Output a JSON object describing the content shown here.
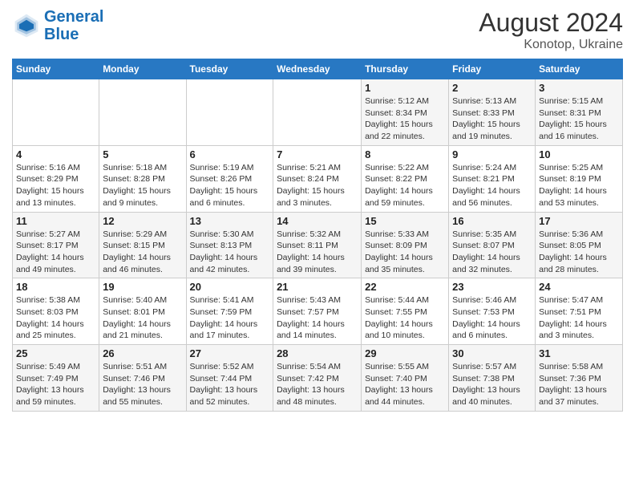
{
  "logo": {
    "text_general": "General",
    "text_blue": "Blue"
  },
  "title": "August 2024",
  "subtitle": "Konotop, Ukraine",
  "days_of_week": [
    "Sunday",
    "Monday",
    "Tuesday",
    "Wednesday",
    "Thursday",
    "Friday",
    "Saturday"
  ],
  "weeks": [
    [
      {
        "day": "",
        "info": ""
      },
      {
        "day": "",
        "info": ""
      },
      {
        "day": "",
        "info": ""
      },
      {
        "day": "",
        "info": ""
      },
      {
        "day": "1",
        "info": "Sunrise: 5:12 AM\nSunset: 8:34 PM\nDaylight: 15 hours and 22 minutes."
      },
      {
        "day": "2",
        "info": "Sunrise: 5:13 AM\nSunset: 8:33 PM\nDaylight: 15 hours and 19 minutes."
      },
      {
        "day": "3",
        "info": "Sunrise: 5:15 AM\nSunset: 8:31 PM\nDaylight: 15 hours and 16 minutes."
      }
    ],
    [
      {
        "day": "4",
        "info": "Sunrise: 5:16 AM\nSunset: 8:29 PM\nDaylight: 15 hours and 13 minutes."
      },
      {
        "day": "5",
        "info": "Sunrise: 5:18 AM\nSunset: 8:28 PM\nDaylight: 15 hours and 9 minutes."
      },
      {
        "day": "6",
        "info": "Sunrise: 5:19 AM\nSunset: 8:26 PM\nDaylight: 15 hours and 6 minutes."
      },
      {
        "day": "7",
        "info": "Sunrise: 5:21 AM\nSunset: 8:24 PM\nDaylight: 15 hours and 3 minutes."
      },
      {
        "day": "8",
        "info": "Sunrise: 5:22 AM\nSunset: 8:22 PM\nDaylight: 14 hours and 59 minutes."
      },
      {
        "day": "9",
        "info": "Sunrise: 5:24 AM\nSunset: 8:21 PM\nDaylight: 14 hours and 56 minutes."
      },
      {
        "day": "10",
        "info": "Sunrise: 5:25 AM\nSunset: 8:19 PM\nDaylight: 14 hours and 53 minutes."
      }
    ],
    [
      {
        "day": "11",
        "info": "Sunrise: 5:27 AM\nSunset: 8:17 PM\nDaylight: 14 hours and 49 minutes."
      },
      {
        "day": "12",
        "info": "Sunrise: 5:29 AM\nSunset: 8:15 PM\nDaylight: 14 hours and 46 minutes."
      },
      {
        "day": "13",
        "info": "Sunrise: 5:30 AM\nSunset: 8:13 PM\nDaylight: 14 hours and 42 minutes."
      },
      {
        "day": "14",
        "info": "Sunrise: 5:32 AM\nSunset: 8:11 PM\nDaylight: 14 hours and 39 minutes."
      },
      {
        "day": "15",
        "info": "Sunrise: 5:33 AM\nSunset: 8:09 PM\nDaylight: 14 hours and 35 minutes."
      },
      {
        "day": "16",
        "info": "Sunrise: 5:35 AM\nSunset: 8:07 PM\nDaylight: 14 hours and 32 minutes."
      },
      {
        "day": "17",
        "info": "Sunrise: 5:36 AM\nSunset: 8:05 PM\nDaylight: 14 hours and 28 minutes."
      }
    ],
    [
      {
        "day": "18",
        "info": "Sunrise: 5:38 AM\nSunset: 8:03 PM\nDaylight: 14 hours and 25 minutes."
      },
      {
        "day": "19",
        "info": "Sunrise: 5:40 AM\nSunset: 8:01 PM\nDaylight: 14 hours and 21 minutes."
      },
      {
        "day": "20",
        "info": "Sunrise: 5:41 AM\nSunset: 7:59 PM\nDaylight: 14 hours and 17 minutes."
      },
      {
        "day": "21",
        "info": "Sunrise: 5:43 AM\nSunset: 7:57 PM\nDaylight: 14 hours and 14 minutes."
      },
      {
        "day": "22",
        "info": "Sunrise: 5:44 AM\nSunset: 7:55 PM\nDaylight: 14 hours and 10 minutes."
      },
      {
        "day": "23",
        "info": "Sunrise: 5:46 AM\nSunset: 7:53 PM\nDaylight: 14 hours and 6 minutes."
      },
      {
        "day": "24",
        "info": "Sunrise: 5:47 AM\nSunset: 7:51 PM\nDaylight: 14 hours and 3 minutes."
      }
    ],
    [
      {
        "day": "25",
        "info": "Sunrise: 5:49 AM\nSunset: 7:49 PM\nDaylight: 13 hours and 59 minutes."
      },
      {
        "day": "26",
        "info": "Sunrise: 5:51 AM\nSunset: 7:46 PM\nDaylight: 13 hours and 55 minutes."
      },
      {
        "day": "27",
        "info": "Sunrise: 5:52 AM\nSunset: 7:44 PM\nDaylight: 13 hours and 52 minutes."
      },
      {
        "day": "28",
        "info": "Sunrise: 5:54 AM\nSunset: 7:42 PM\nDaylight: 13 hours and 48 minutes."
      },
      {
        "day": "29",
        "info": "Sunrise: 5:55 AM\nSunset: 7:40 PM\nDaylight: 13 hours and 44 minutes."
      },
      {
        "day": "30",
        "info": "Sunrise: 5:57 AM\nSunset: 7:38 PM\nDaylight: 13 hours and 40 minutes."
      },
      {
        "day": "31",
        "info": "Sunrise: 5:58 AM\nSunset: 7:36 PM\nDaylight: 13 hours and 37 minutes."
      }
    ]
  ]
}
